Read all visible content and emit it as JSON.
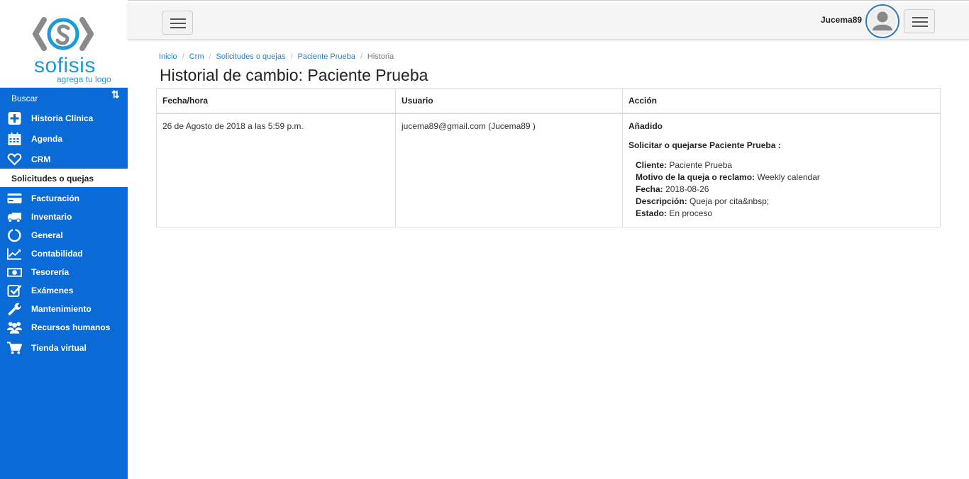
{
  "app": {
    "logo_text": "sofisis",
    "logo_sub": "agrega tu logo",
    "user": "Jucema89"
  },
  "sidebar": {
    "search_label": "Buscar",
    "items": [
      {
        "label": "Historia Clínica",
        "icon": "plus-square-icon"
      },
      {
        "label": "Agenda",
        "icon": "calendar-icon"
      },
      {
        "label": "CRM",
        "icon": "heart-icon"
      },
      {
        "label": "Facturación",
        "icon": "credit-card-icon"
      },
      {
        "label": "Inventario",
        "icon": "truck-icon"
      },
      {
        "label": "General",
        "icon": "circle-notch-icon"
      },
      {
        "label": "Contabilidad",
        "icon": "line-chart-icon"
      },
      {
        "label": "Tesorería",
        "icon": "money-icon"
      },
      {
        "label": "Exámenes",
        "icon": "check-square-icon"
      },
      {
        "label": "Mantenimiento",
        "icon": "wrench-icon"
      },
      {
        "label": "Recursos humanos",
        "icon": "users-icon"
      },
      {
        "label": "Tienda virtual",
        "icon": "shopping-cart-icon"
      }
    ],
    "sub_item": "Solicitudes o quejas"
  },
  "breadcrumb": {
    "items": [
      "Inicio",
      "Crm",
      "Solicitudes o quejas",
      "Paciente Prueba"
    ],
    "current": "Historia"
  },
  "page": {
    "title": "Historial de cambio: Paciente Prueba"
  },
  "table": {
    "headers": [
      "Fecha/hora",
      "Usuario",
      "Acción"
    ],
    "rows": [
      {
        "fecha": "26 de Agosto de 2018 a las 5:59 p.m.",
        "usuario": "jucema89@gmail.com (Jucema89 )",
        "accion": {
          "title": "Añadido",
          "subtitle": "Solicitar o quejarse Paciente Prueba :",
          "fields": [
            {
              "label": "Cliente:",
              "value": "Paciente Prueba"
            },
            {
              "label": "Motivo de la queja o reclamo:",
              "value": "Weekly calendar"
            },
            {
              "label": "Fecha:",
              "value": "2018-08-26"
            },
            {
              "label": "Descripción:",
              "value": "Queja por cita&nbsp;"
            },
            {
              "label": "Estado:",
              "value": "En proceso"
            }
          ]
        }
      }
    ]
  },
  "colors": {
    "sidebar_bg": "#0a6bd6",
    "link": "#1a84d0",
    "logo": "#1a9bd7"
  }
}
